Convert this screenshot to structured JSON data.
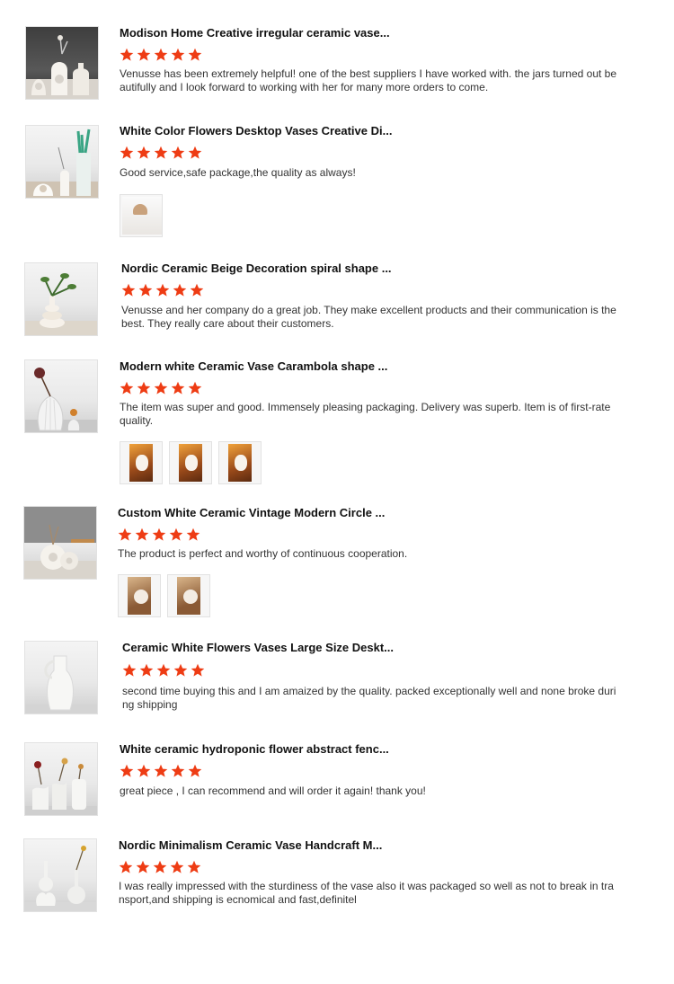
{
  "accent_color": "#ee3c14",
  "reviews": [
    {
      "title": "Modison Home Creative irregular ceramic vase...",
      "rating": 5,
      "text": "Venusse has been extremely helpful! one of the best suppliers I have worked with. the jars turned out beautifully and I look forward to working with her for many more orders to come.",
      "thumb_icon": "vase-product-icon",
      "photos": []
    },
    {
      "title": "White Color Flowers Desktop Vases Creative Di...",
      "rating": 5,
      "text": "Good service,safe package,the quality as always!",
      "thumb_icon": "vase-product-icon",
      "photos": [
        "lamp-photo"
      ]
    },
    {
      "title": "Nordic Ceramic Beige Decoration spiral shape ...",
      "rating": 5,
      "text": "Venusse and her company do a great job. They make excellent products and their communication is the best. They really care about their customers.",
      "thumb_icon": "vase-product-icon",
      "photos": []
    },
    {
      "title": "Modern white Ceramic Vase Carambola shape ...",
      "rating": 5,
      "text": "The item was super and good. Immensely pleasing packaging. Delivery was superb. Item is of first-rate quality.",
      "thumb_icon": "vase-product-icon",
      "photos": [
        "amber-photo",
        "amber-photo",
        "amber-photo"
      ]
    },
    {
      "title": "Custom White Ceramic Vintage Modern Circle ...",
      "rating": 5,
      "text": "The product is perfect and worthy of continuous cooperation.",
      "thumb_icon": "vase-product-icon",
      "photos": [
        "cream-photo",
        "cream-photo"
      ]
    },
    {
      "title": "Ceramic White Flowers Vases Large Size Deskt...",
      "rating": 5,
      "text": "second time buying this and I am amaized by the quality. packed exceptionally well and none broke during shipping",
      "thumb_icon": "vase-product-icon",
      "photos": []
    },
    {
      "title": "White ceramic hydroponic flower abstract fenc...",
      "rating": 5,
      "text": "great piece , I can recommend and will order it again! thank you!",
      "thumb_icon": "vase-product-icon",
      "photos": []
    },
    {
      "title": "Nordic Minimalism Ceramic Vase Handcraft M...",
      "rating": 5,
      "text": "I was really impressed with the sturdiness of the vase also it was packaged so well as not to break in transport,and shipping is ecnomical and fast,definitel",
      "thumb_icon": "vase-product-icon",
      "photos": []
    }
  ]
}
